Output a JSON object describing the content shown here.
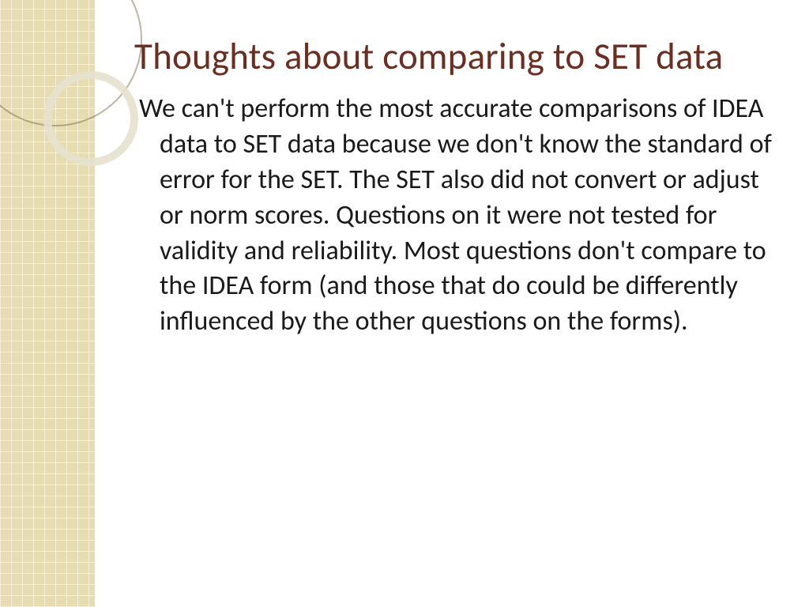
{
  "slide": {
    "title": "Thoughts about comparing to SET data",
    "body": "We can't perform the most accurate comparisons of IDEA data to SET data because we don't know the standard of error for the SET.  The SET also did not convert or adjust or norm scores. Questions on it were not tested for validity and reliability.  Most questions don't compare to the IDEA form (and those that do could be differently influenced by the other questions on the forms)."
  }
}
